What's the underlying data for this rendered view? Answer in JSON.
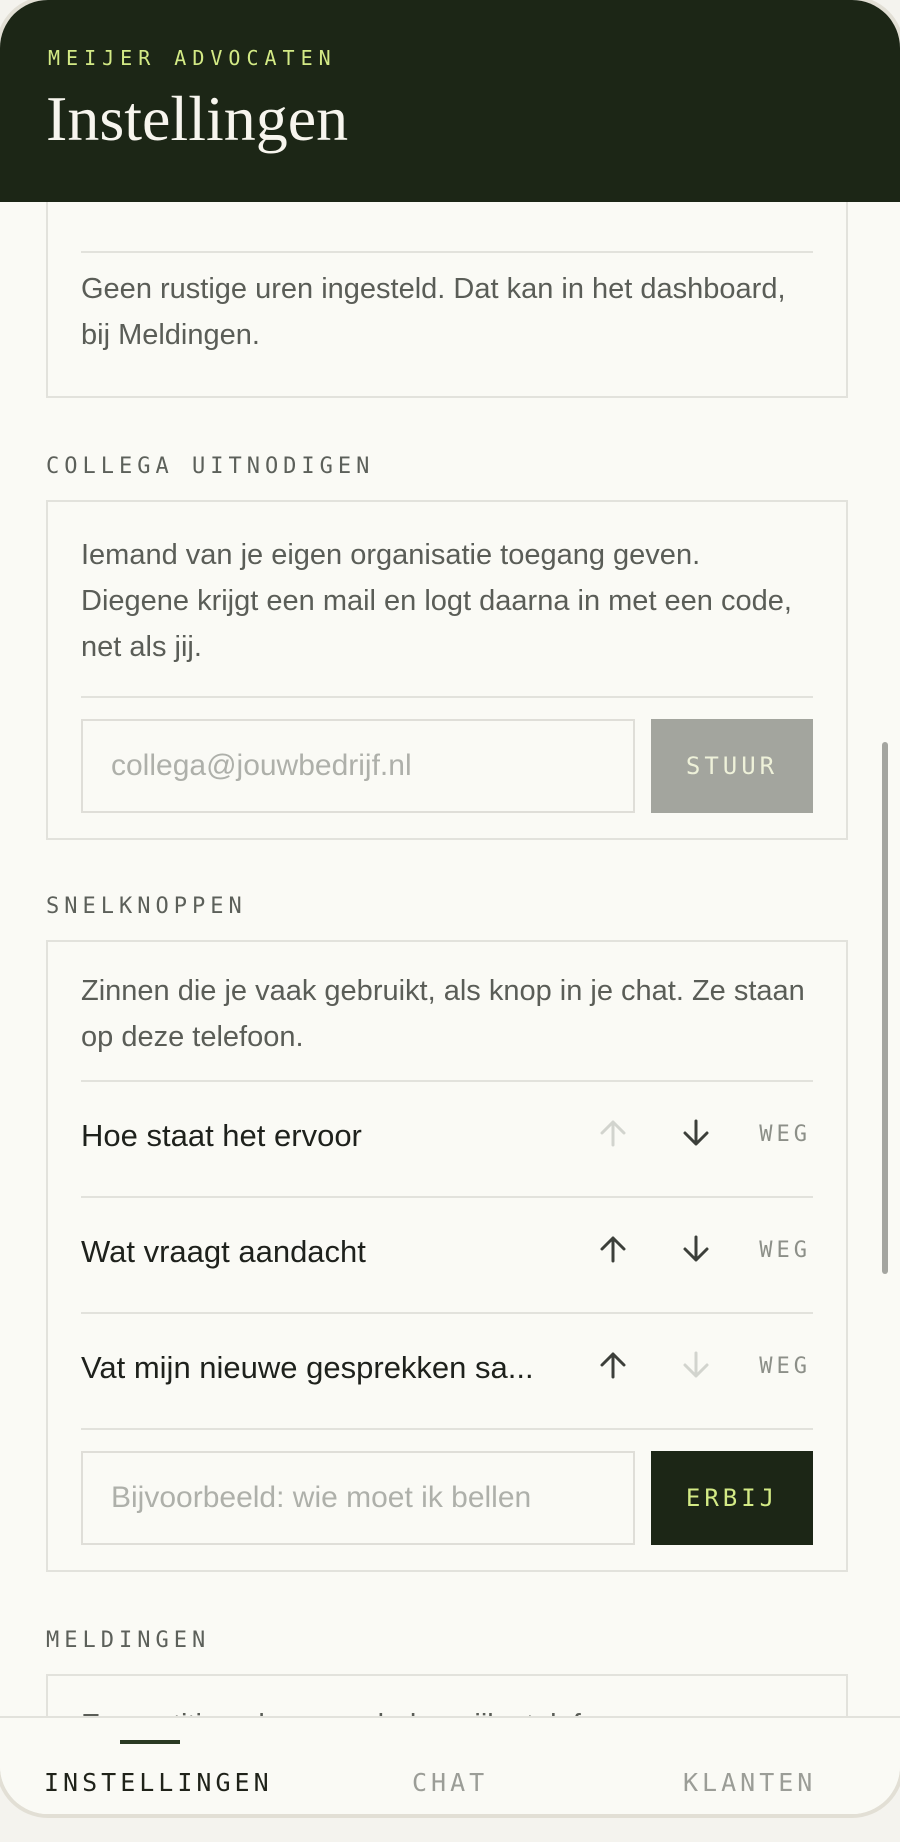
{
  "header": {
    "brand": "MEIJER ADVOCATEN",
    "title": "Instellingen"
  },
  "quiet_hours": {
    "text": "Geen rustige uren ingesteld. Dat kan in het dashboard, bij Meldingen."
  },
  "invite": {
    "label": "COLLEGA UITNODIGEN",
    "text": "Iemand van je eigen organisatie toegang geven. Diegene krijgt een mail en logt daarna in met een code, net als jij.",
    "placeholder": "collega@jouwbedrijf.nl",
    "button": "STUUR"
  },
  "shortcuts": {
    "label": "SNELKNOPPEN",
    "text": "Zinnen die je vaak gebruikt, als knop in je chat. Ze staan op deze telefoon.",
    "items": [
      {
        "label": "Hoe staat het ervoor",
        "remove": "WEG"
      },
      {
        "label": "Wat vraagt aandacht",
        "remove": "WEG"
      },
      {
        "label": "Vat mijn nieuwe gesprekken sa...",
        "remove": "WEG"
      }
    ],
    "placeholder": "Bijvoorbeeld: wie moet ik bellen",
    "add_button": "ERBIJ"
  },
  "notifications": {
    "label": "MELDINGEN",
    "text": "Een notitie ook op een belangrijke telefoon"
  },
  "nav": {
    "tab1": "INSTELLINGEN",
    "tab2": "CHAT",
    "tab3": "KLANTEN"
  },
  "colors": {
    "header_bg": "#1c2616",
    "accent": "#d3ea85",
    "button_disabled": "#a3a59e"
  }
}
